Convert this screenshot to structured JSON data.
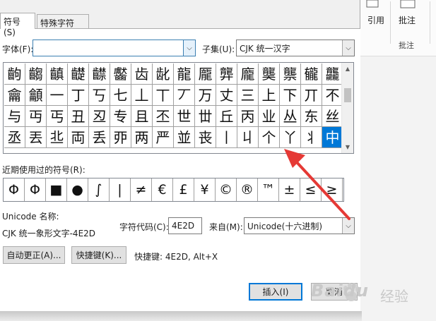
{
  "ribbon": {
    "items": [
      "引用",
      "批注",
      "批注"
    ]
  },
  "dialog": {
    "tabs": [
      "符号(S)",
      "特殊字符(P)"
    ],
    "font_label": "字体(F):",
    "font_value": "",
    "subset_label": "子集(U):",
    "subset_value": "CJK 统一汉字",
    "symbol_rows": [
      [
        "齣",
        "齺",
        "齻",
        "齼",
        "齽",
        "齾",
        "齿",
        "龀",
        "龍",
        "龎",
        "龏",
        "龐",
        "龑",
        "龒",
        "龓",
        "龘"
      ],
      [
        "龠",
        "龥",
        "一",
        "丁",
        "丂",
        "七",
        "丄",
        "丅",
        "丆",
        "万",
        "丈",
        "三",
        "上",
        "下",
        "丌",
        "不"
      ],
      [
        "与",
        "丏",
        "丐",
        "丑",
        "丒",
        "专",
        "且",
        "丕",
        "世",
        "丗",
        "丘",
        "丙",
        "业",
        "丛",
        "东",
        "丝"
      ],
      [
        "丞",
        "丟",
        "丠",
        "両",
        "丢",
        "丣",
        "两",
        "严",
        "並",
        "丧",
        "丨",
        "丩",
        "个",
        "丫",
        "丬",
        "中"
      ]
    ],
    "selected_symbol": "中",
    "recent_label": "近期使用过的符号(R):",
    "recent_symbols": [
      "Φ",
      "Φ",
      "■",
      "●",
      "∫",
      "|",
      "≠",
      "€",
      "£",
      "¥",
      "©",
      "®",
      "™",
      "±",
      "≤",
      "≥"
    ],
    "unicode_name_label": "Unicode 名称:",
    "unicode_name_value": "CJK 统一象形文字-4E2D",
    "char_code_label": "字符代码(C):",
    "char_code_value": "4E2D",
    "from_label": "来自(M):",
    "from_value": "Unicode(十六进制)",
    "autocorrect_button": "自动更正(A)...",
    "shortcut_key_button": "快捷键(K)...",
    "shortcut_text": "快捷键: 4E2D, Alt+X",
    "insert_button": "插入(I)",
    "cancel_button": "取消"
  },
  "watermark": {
    "brand": "Baidu",
    "sub": "经验"
  },
  "colors": {
    "selection": "#0078d7",
    "annotation_arrow": "#e53935"
  }
}
